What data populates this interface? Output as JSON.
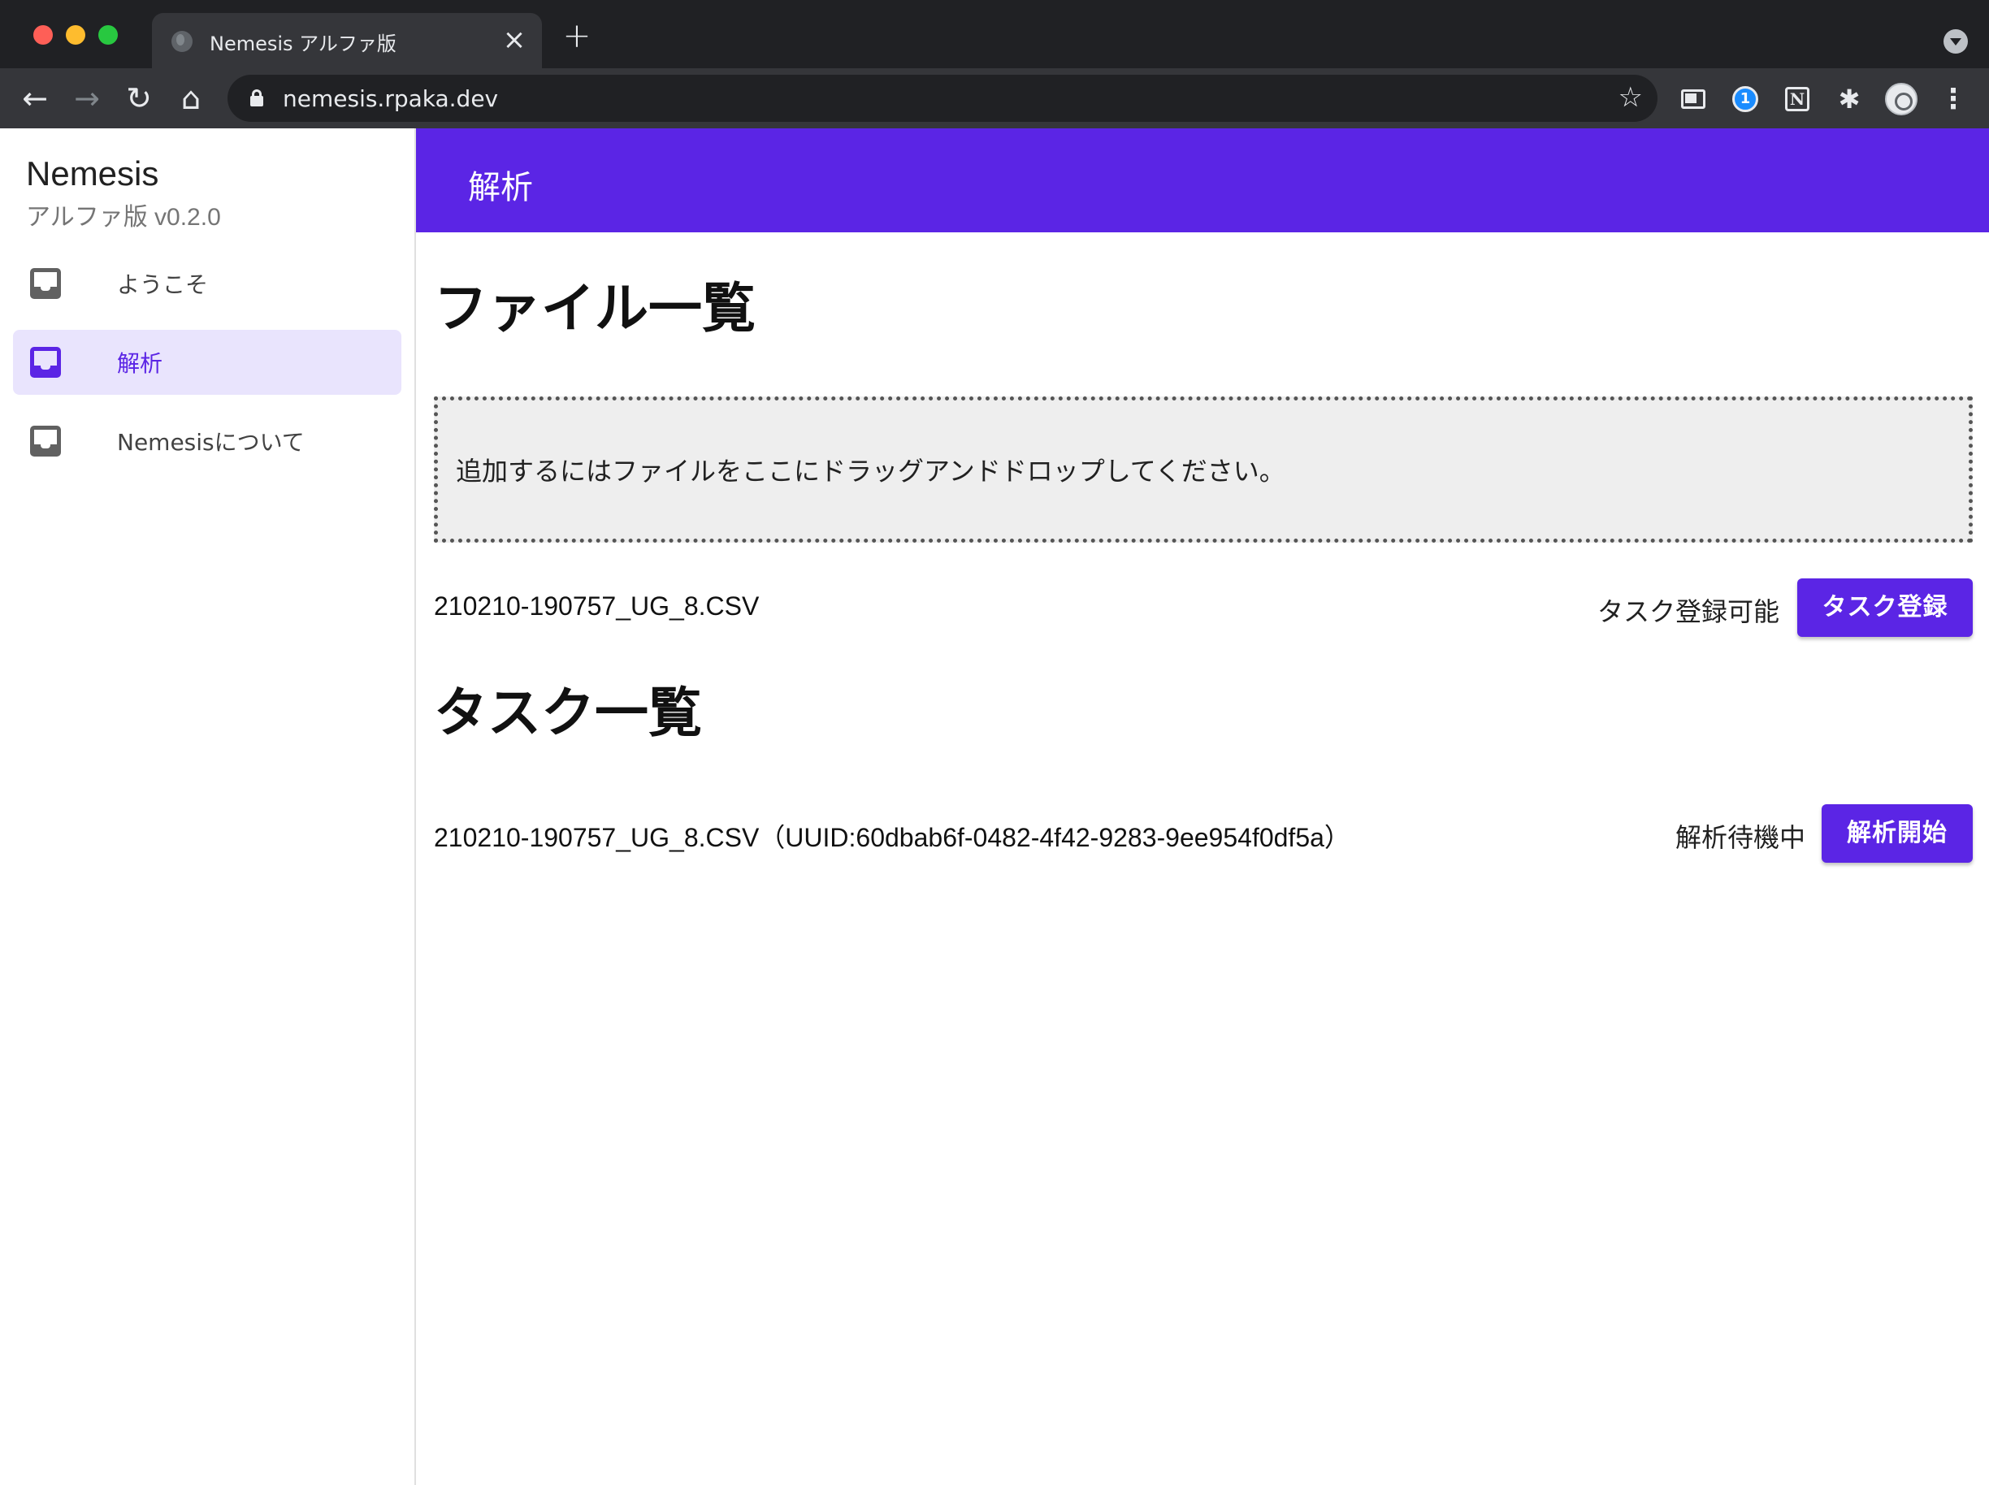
{
  "browser": {
    "tab_title": "Nemesis アルファ版",
    "tab_close_icon": "×",
    "new_tab_icon": "+",
    "url": "nemesis.rpaka.dev",
    "back_icon": "←",
    "forward_icon": "→",
    "reload_icon": "↻",
    "home_icon": "⌂",
    "star_icon": "☆",
    "puzzle_icon": "✱",
    "menu_icon": "⋮",
    "onepassword_glyph": "1",
    "notion_glyph": "N"
  },
  "sidebar": {
    "title": "Nemesis",
    "subtitle": "アルファ版 v0.2.0",
    "items": [
      {
        "label": "ようこそ",
        "icon": "inbox-icon",
        "active": false
      },
      {
        "label": "解析",
        "icon": "inbox-icon",
        "active": true
      },
      {
        "label": "Nemesisについて",
        "icon": "inbox-icon",
        "active": false
      }
    ]
  },
  "header": {
    "title": "解析"
  },
  "main": {
    "files_heading": "ファイル一覧",
    "dropzone_text": "追加するにはファイルをここにドラッグアンドドロップしてください。",
    "files": [
      {
        "name": "210210-190757_UG_8.CSV",
        "status": "タスク登録可能",
        "action": "タスク登録"
      }
    ],
    "tasks_heading": "タスク一覧",
    "tasks": [
      {
        "name": "210210-190757_UG_8.CSV（UUID:60dbab6f-0482-4f42-9283-9ee954f0df5a）",
        "status": "解析待機中",
        "action": "解析開始"
      }
    ]
  },
  "colors": {
    "accent": "#5b25e5",
    "active_bg": "#e9e4fd",
    "dropzone_bg": "#eeeeee"
  }
}
